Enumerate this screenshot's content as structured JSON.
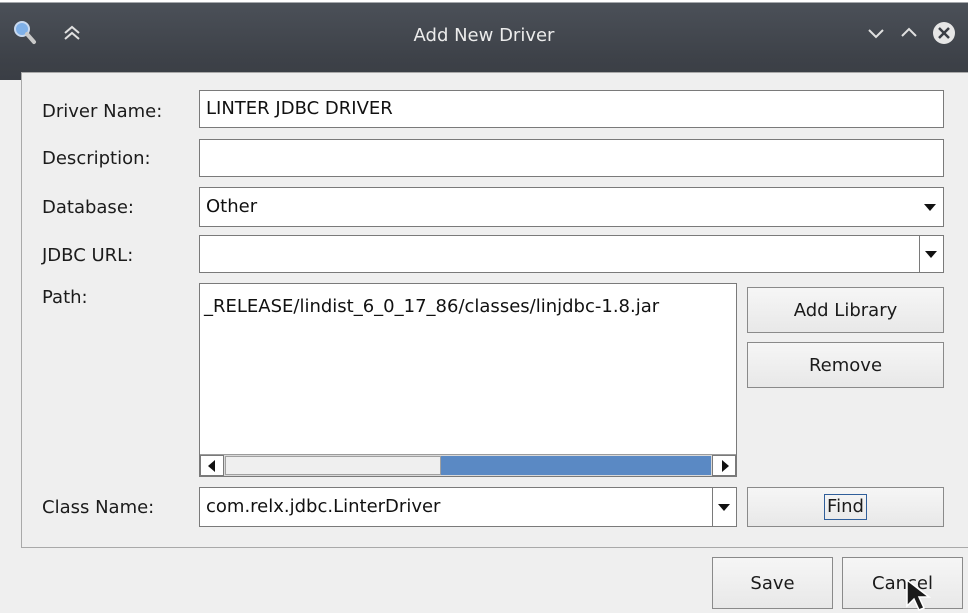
{
  "window": {
    "title": "Add New Driver"
  },
  "form": {
    "driver_name_label": "Driver Name:",
    "driver_name_value": "LINTER JDBC DRIVER",
    "description_label": "Description:",
    "description_value": "",
    "database_label": "Database:",
    "database_value": "Other",
    "jdbc_url_label": "JDBC URL:",
    "jdbc_url_value": "",
    "path_label": "Path:",
    "path_items": [
      "_RELEASE/lindist_6_0_17_86/classes/linjdbc-1.8.jar"
    ],
    "class_name_label": "Class Name:",
    "class_name_value": "com.relx.jdbc.LinterDriver"
  },
  "buttons": {
    "add_library": "Add Library",
    "remove": "Remove",
    "find": "Find",
    "save": "Save",
    "cancel": "Cancel"
  },
  "path_scroll_position": 0.95,
  "icons": {
    "app": "magnifier-icon",
    "shade": "double-chevron-up-icon",
    "minimize": "chevron-down-icon",
    "maximize": "chevron-up-icon",
    "close": "close-circle-icon"
  },
  "colors": {
    "titlebar": "#3d4148",
    "scroll_thumb": "#5a89c4",
    "focus_border": "#2f5e9a"
  }
}
